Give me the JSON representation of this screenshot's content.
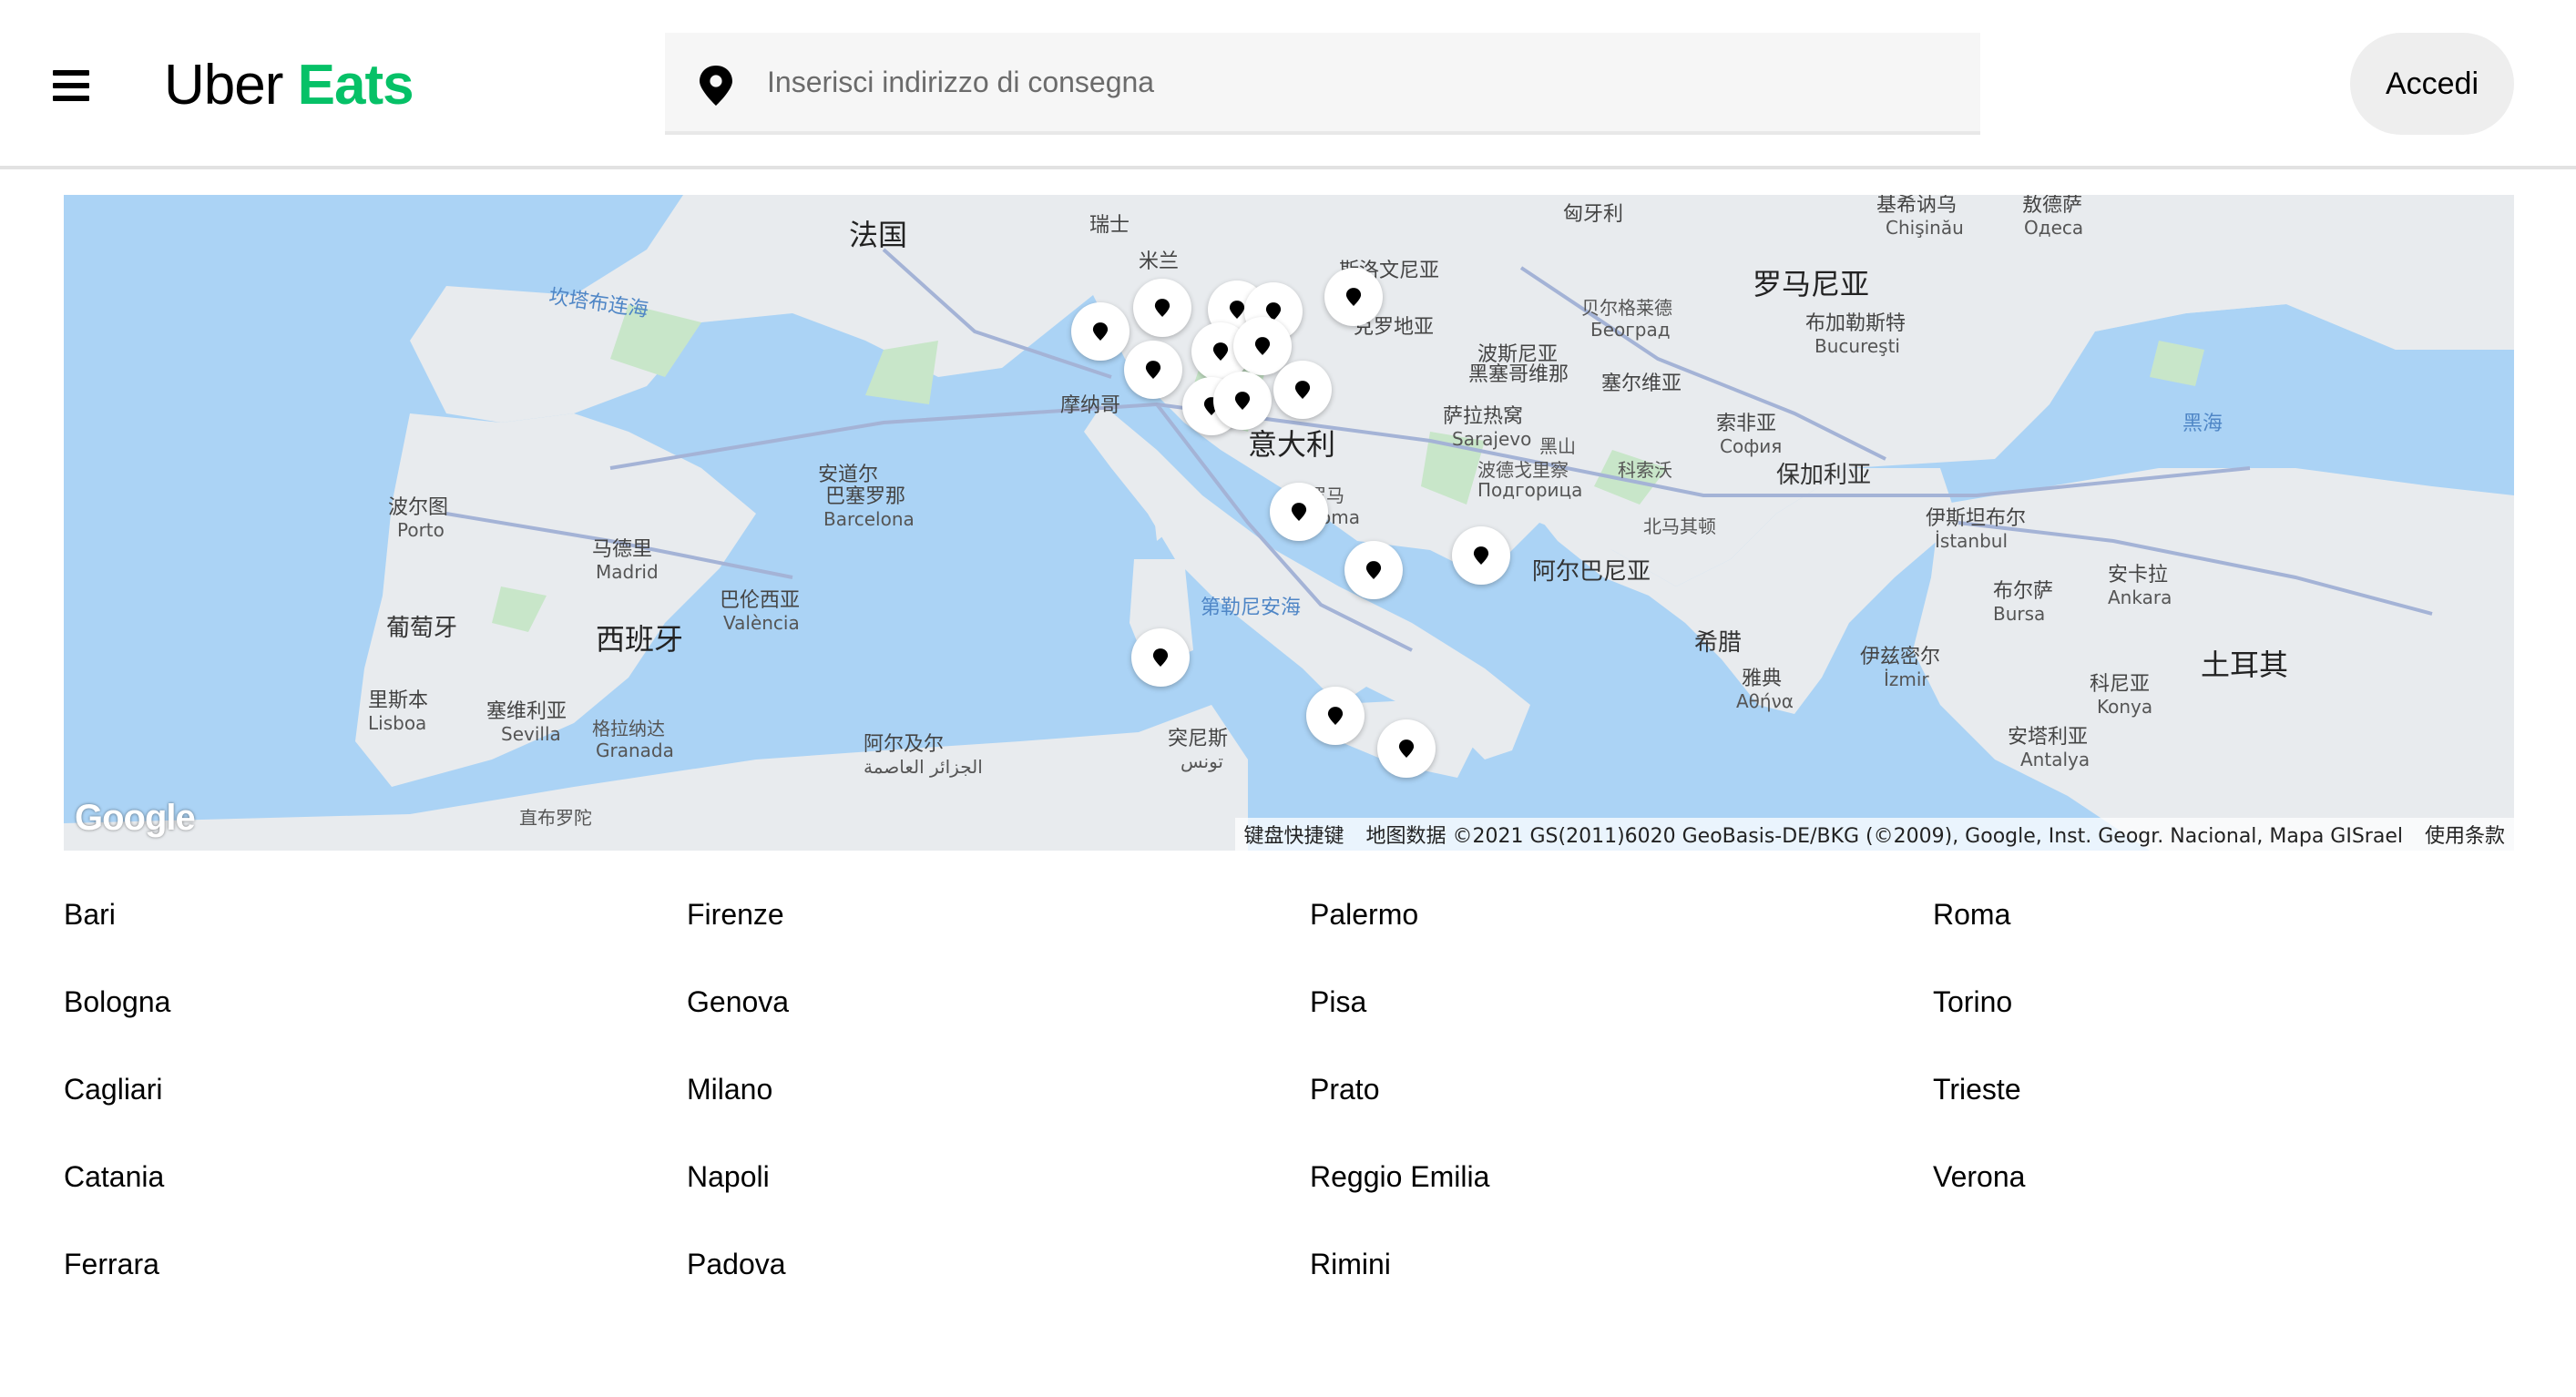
{
  "header": {
    "logo_uber": "Uber",
    "logo_eats": "Eats",
    "search_placeholder": "Inserisci indirizzo di consegna",
    "login_label": "Accedi",
    "brand_color": "#06c167"
  },
  "map": {
    "labels": {
      "france": "法国",
      "switzerland": "瑞士",
      "milan": "米兰",
      "monaco": "摩纳哥",
      "slovenia": "斯洛文尼亚",
      "croatia": "克罗地亚",
      "hungary": "匈牙利",
      "romania": "罗马尼亚",
      "chisinau": "基希讷乌",
      "chisinau_latin": "Chişinău",
      "odessa": "敖德萨",
      "odessa_latin": "Одеса",
      "bucharest": "布加勒斯特",
      "bucharest_latin": "Bucureşti",
      "belgrade": "贝尔格莱德",
      "belgrade_latin": "Београд",
      "serbia": "塞尔维亚",
      "bih": "波斯尼亚",
      "bih2": "黑塞哥维那",
      "sarajevo": "萨拉热窝",
      "sarajevo_latin": "Sarajevo",
      "montenegro": "黑山",
      "podgorica": "波德戈里察",
      "podgorica_latin": "Подгорица",
      "kosovo": "科索沃",
      "north_macedonia": "北马其顿",
      "sofia": "索非亚",
      "sofia_latin": "София",
      "bulgaria": "保加利亚",
      "black_sea": "黑海",
      "italy": "意大利",
      "rome": "罗马",
      "rome_latin": "Roma",
      "albania": "阿尔巴尼亚",
      "greece": "希腊",
      "athens": "雅典",
      "athens_latin": "Αθήνα",
      "istanbul": "伊斯坦布尔",
      "istanbul_latin": "İstanbul",
      "bursa": "布尔萨",
      "bursa_latin": "Bursa",
      "ankara": "安卡拉",
      "ankara_latin": "Ankara",
      "izmir": "伊兹密尔",
      "izmir_latin": "İzmir",
      "turkey": "土耳其",
      "konya": "科尼亚",
      "konya_latin": "Konya",
      "antalya": "安塔利亚",
      "antalya_latin": "Antalya",
      "bay_biscay": "坎塔布连海",
      "andorra": "安道尔",
      "barcelona": "巴塞罗那",
      "barcelona_latin": "Barcelona",
      "porto": "波尔图",
      "porto_latin": "Porto",
      "madrid": "马德里",
      "madrid_latin": "Madrid",
      "valencia": "巴伦西亚",
      "valencia_latin": "València",
      "portugal": "葡萄牙",
      "spain": "西班牙",
      "lisbon": "里斯本",
      "lisbon_latin": "Lisboa",
      "seville": "塞维利亚",
      "seville_latin": "Sevilla",
      "granada": "格拉纳达",
      "granada_latin": "Granada",
      "gibraltar": "直布罗陀",
      "algiers": "阿尔及尔",
      "algiers_latin": "الجزائر العاصمة",
      "tunis": "突尼斯",
      "tunis_latin": "تونس",
      "tyrrhenian": "第勒尼安海"
    },
    "google_logo": "Google",
    "attribution": {
      "shortcuts": "键盘快捷键",
      "data": "地图数据 ©2021 GS(2011)6020 GeoBasis-DE/BKG (©2009), Google, Inst. Geogr. Nacional, Mapa GISrael",
      "terms": "使用条款"
    }
  },
  "cities": [
    [
      "Bari",
      "Firenze",
      "Palermo",
      "Roma"
    ],
    [
      "Bologna",
      "Genova",
      "Pisa",
      "Torino"
    ],
    [
      "Cagliari",
      "Milano",
      "Prato",
      "Trieste"
    ],
    [
      "Catania",
      "Napoli",
      "Reggio Emilia",
      "Verona"
    ],
    [
      "Ferrara",
      "Padova",
      "Rimini",
      ""
    ]
  ]
}
